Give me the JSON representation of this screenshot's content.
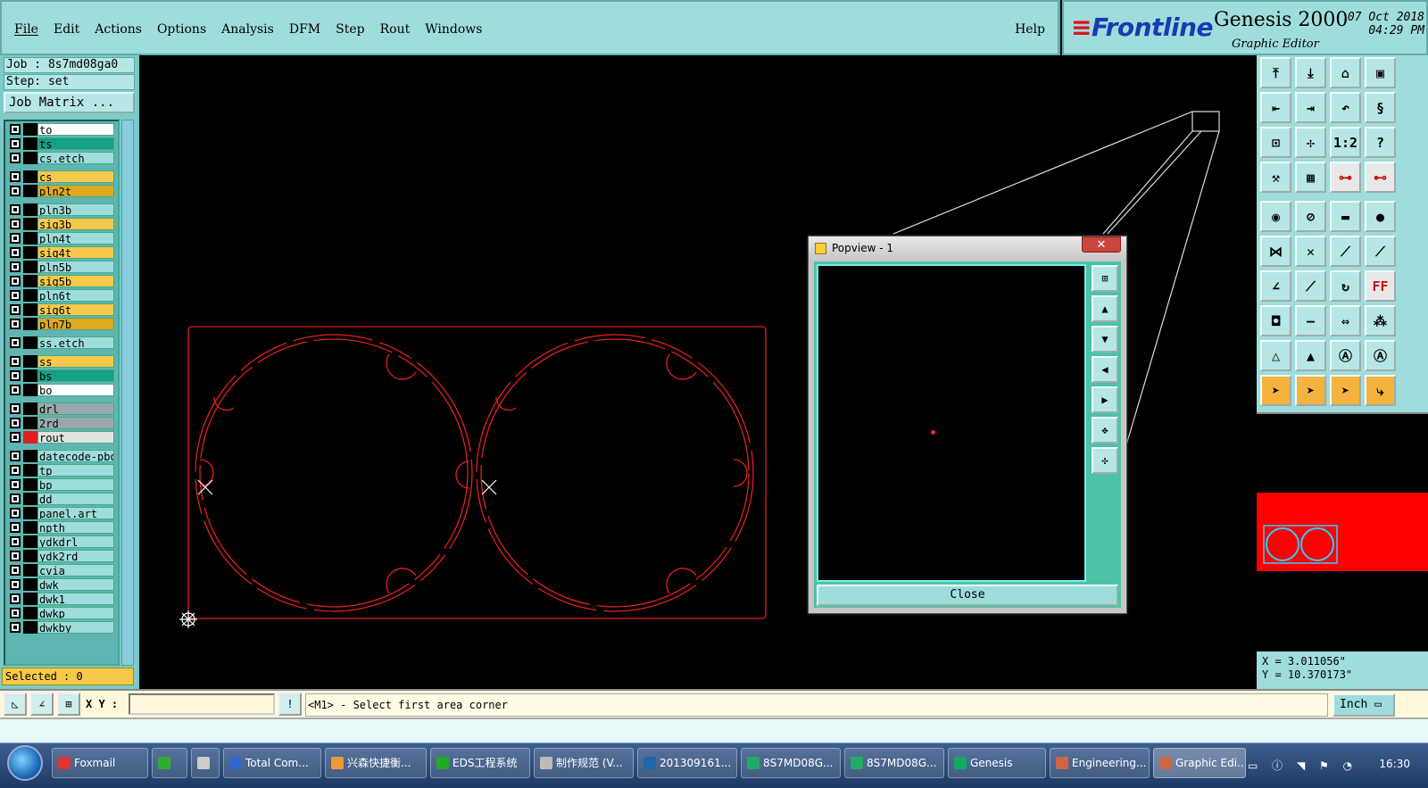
{
  "menu": {
    "items": [
      "File",
      "Edit",
      "Actions",
      "Options",
      "Analysis",
      "DFM",
      "Step",
      "Rout",
      "Windows"
    ],
    "help": "Help"
  },
  "branding": {
    "brand": "Frontline",
    "product": "Genesis 2000",
    "subtitle": "Graphic Editor",
    "date": "07 Oct 2018",
    "time": "04:29 PM"
  },
  "job": {
    "job_label": "Job : 8s7md08ga0",
    "step_label": "Step: set",
    "matrix_button": "Job Matrix ..."
  },
  "layers": [
    {
      "name": "to",
      "color": "#ffffff"
    },
    {
      "name": "ts",
      "color": "#16a085"
    },
    {
      "name": "cs.etch",
      "color": "#9fdcdc"
    },
    {
      "name": "cs",
      "color": "#f7c94a"
    },
    {
      "name": "pln2t",
      "color": "#e0a81e"
    },
    {
      "name": "pln3b",
      "color": "#9fdcdc"
    },
    {
      "name": "sig3b",
      "color": "#f7c94a"
    },
    {
      "name": "pln4t",
      "color": "#9fdcdc"
    },
    {
      "name": "sig4t",
      "color": "#f7c94a"
    },
    {
      "name": "pln5b",
      "color": "#9fdcdc"
    },
    {
      "name": "sig5b",
      "color": "#f7c94a"
    },
    {
      "name": "pln6t",
      "color": "#9fdcdc"
    },
    {
      "name": "sig6t",
      "color": "#f7c94a"
    },
    {
      "name": "pln7b",
      "color": "#e0a81e"
    },
    {
      "name": "ss.etch",
      "color": "#9fdcdc"
    },
    {
      "name": "ss",
      "color": "#f7c94a"
    },
    {
      "name": "bs",
      "color": "#16a085"
    },
    {
      "name": "bo",
      "color": "#ffffff"
    },
    {
      "name": "drl",
      "color": "#9aa8ad"
    },
    {
      "name": "2rd",
      "color": "#9aa8ad"
    },
    {
      "name": "rout",
      "color": "#e2e2e2"
    },
    {
      "name": "datecode-pbo",
      "color": "#9fdcdc"
    },
    {
      "name": "tp",
      "color": "#9fdcdc"
    },
    {
      "name": "bp",
      "color": "#9fdcdc"
    },
    {
      "name": "dd",
      "color": "#9fdcdc"
    },
    {
      "name": "panel.art",
      "color": "#9fdcdc"
    },
    {
      "name": "npth",
      "color": "#9fdcdc"
    },
    {
      "name": "ydkdrl",
      "color": "#9fdcdc"
    },
    {
      "name": "ydk2rd",
      "color": "#9fdcdc"
    },
    {
      "name": "cvia",
      "color": "#9fdcdc"
    },
    {
      "name": "dwk",
      "color": "#9fdcdc"
    },
    {
      "name": "dwk1",
      "color": "#9fdcdc"
    },
    {
      "name": "dwkp",
      "color": "#9fdcdc"
    },
    {
      "name": "dwkby",
      "color": "#9fdcdc"
    }
  ],
  "selected": "Selected : 0",
  "popview": {
    "title": "Popview - 1",
    "close_label": "Close"
  },
  "coords": {
    "x": "X = 3.011056\"",
    "y": "Y = 10.370173\""
  },
  "command": {
    "xy_label": "X Y :",
    "xy_value": "",
    "prompt": "<M1> - Select first area corner",
    "units": "Inch"
  },
  "taskbar": {
    "tasks": [
      {
        "label": "Foxmail",
        "icon": "#d33"
      },
      {
        "label": "",
        "icon": "#3a3"
      },
      {
        "label": "",
        "icon": "#ccc"
      },
      {
        "label": "Total Com...",
        "icon": "#36c"
      },
      {
        "label": "兴森快捷衡...",
        "icon": "#e93"
      },
      {
        "label": "EDS工程系统",
        "icon": "#2a2"
      },
      {
        "label": "制作规范 (V...",
        "icon": "#bbb"
      },
      {
        "label": "201309161...",
        "icon": "#26a"
      },
      {
        "label": "8S7MD08G...",
        "icon": "#2a6"
      },
      {
        "label": "8S7MD08G...",
        "icon": "#2a6"
      },
      {
        "label": "Genesis",
        "icon": "#1a6"
      },
      {
        "label": "Engineering...",
        "icon": "#c64"
      },
      {
        "label": "Graphic Edi...",
        "icon": "#c64"
      }
    ],
    "time": "16:30"
  },
  "colors": {
    "panel": "#9fdcdc",
    "profile": "#e02020",
    "background": "#000000"
  }
}
